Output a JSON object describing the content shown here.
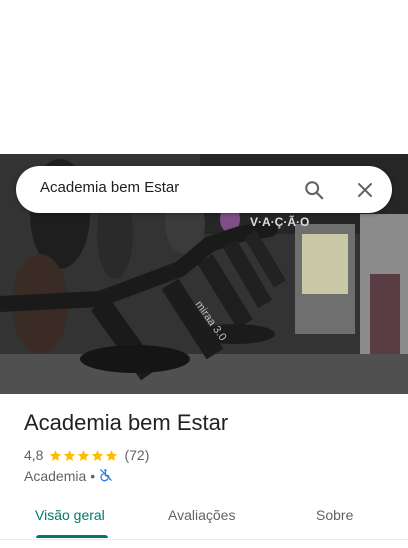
{
  "search": {
    "query": "Academia bem Estar"
  },
  "hero": {
    "sign_text": "V·A·Ç·Ã·O",
    "treadmill_brand": "miraa 3.0"
  },
  "place": {
    "name": "Academia bem Estar",
    "rating": "4,8",
    "stars": 5,
    "review_count": "(72)",
    "category": "Academia",
    "separator": "•"
  },
  "tabs": [
    {
      "label": "Visão geral",
      "active": true
    },
    {
      "label": "Avaliações",
      "active": false
    },
    {
      "label": "Sobre",
      "active": false
    }
  ],
  "colors": {
    "accent": "#00796b",
    "star": "#fbbc04",
    "accessibility_icon": "#1a73e8"
  },
  "icons": {
    "search": "search-icon",
    "close": "close-icon",
    "accessibility": "no-wheelchair-icon"
  }
}
